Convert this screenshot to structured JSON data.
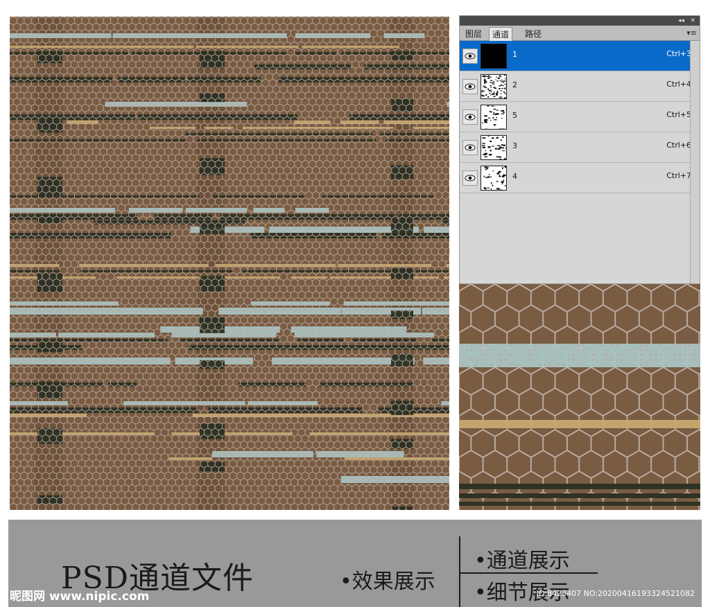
{
  "colors": {
    "background": "#7a5c43",
    "hex_mesh": "#b9aba0",
    "blue_stripe": "#a9c4c4",
    "tan_stripe": "#c8a870",
    "dark_stripe": "#2a2f22",
    "selected": "#0a6ac9"
  },
  "panel": {
    "tabs": [
      "图层",
      "通道",
      "路径"
    ],
    "active_tab": "通道",
    "collapse_glyph": "◂◂",
    "close_glyph": "✕",
    "menu_glyph": "▾≡",
    "channels": [
      {
        "name": "1",
        "shortcut": "Ctrl+3",
        "selected": true,
        "thumb": "black"
      },
      {
        "name": "2",
        "shortcut": "Ctrl+4",
        "selected": false,
        "thumb": "noise"
      },
      {
        "name": "5",
        "shortcut": "Ctrl+5",
        "selected": false,
        "thumb": "sparse"
      },
      {
        "name": "3",
        "shortcut": "Ctrl+6",
        "selected": false,
        "thumb": "sparse"
      },
      {
        "name": "4",
        "shortcut": "Ctrl+7",
        "selected": false,
        "thumb": "sparse"
      }
    ],
    "eye_icon": "eye-icon"
  },
  "banner": {
    "title": "PSD通道文件",
    "effects_label": "•效果展示",
    "channels_label": "•通道展示",
    "detail_label": "•细节展示"
  },
  "watermark": {
    "left": "昵图网 www.nipic.com",
    "right": "ID:8423407 NO:20200416193324521082"
  }
}
